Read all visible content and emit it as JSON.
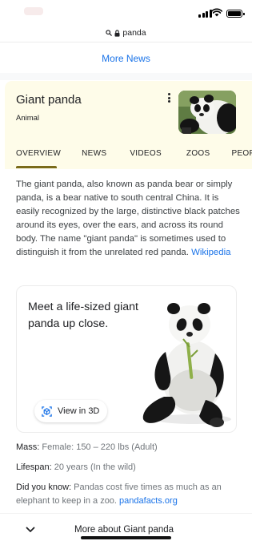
{
  "url_bar": {
    "domain": "panda"
  },
  "more_news": "More News",
  "knowledge_panel": {
    "title": "Giant panda",
    "subtitle": "Animal",
    "tabs": [
      "OVERVIEW",
      "NEWS",
      "VIDEOS",
      "ZOOS",
      "PEOP"
    ],
    "active_tab": "OVERVIEW"
  },
  "description": {
    "text": "The giant panda, also known as panda bear or simply panda, is a bear native to south central China. It is easily recognized by the large, distinctive black patches around its eyes, over the ears, and across its round body. The name \"giant panda\" is sometimes used to distinguish it from the unrelated red panda. ",
    "source_link": "Wikipedia"
  },
  "view_3d_card": {
    "text": "Meet a life-sized giant panda up close.",
    "button_label": "View in 3D"
  },
  "facts": {
    "mass_label": "Mass:",
    "mass_value": "Female: 150 – 220 lbs (Adult)",
    "lifespan_label": "Lifespan:",
    "lifespan_value": "20 years (In the wild)",
    "did_you_know_label": "Did you know:",
    "did_you_know_value": "Pandas cost five times as much as an elephant to keep in a zoo. ",
    "did_you_know_source": "pandafacts.org"
  },
  "more_about": "More about Giant panda",
  "icons": {
    "search": "search-icon",
    "lock": "lock-icon",
    "menu": "more-vert-icon",
    "cube": "3d-cube-icon",
    "chevron": "chevron-down-icon"
  },
  "colors": {
    "link": "#1a73e8",
    "panel_bg": "#fefce9",
    "tab_indicator": "#7a6b1a"
  }
}
